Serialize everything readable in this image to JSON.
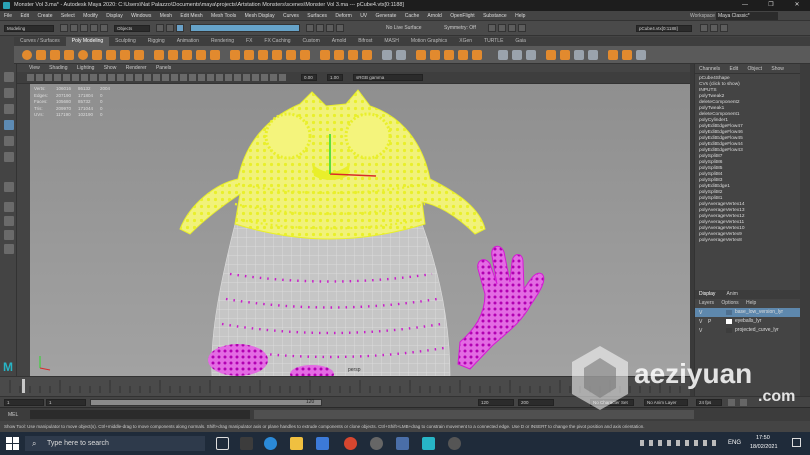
{
  "window": {
    "title": "Monster Vol 3.ma* - Autodesk Maya 2020: C:\\Users\\Nat Palazzo\\Documents\\maya\\projects\\Artstation Monsters\\scenes\\Monster Vol 3.ma  ---  pCube4.vtx[0:1188]",
    "minimize": "—",
    "maximize": "❐",
    "close": "✕"
  },
  "menu": [
    "File",
    "Edit",
    "Create",
    "Select",
    "Modify",
    "Display",
    "Windows",
    "Mesh",
    "Edit Mesh",
    "Mesh Tools",
    "Mesh Display",
    "Curves",
    "Surfaces",
    "Deform",
    "UV",
    "Generate",
    "Cache",
    "Arnold",
    "OpenFlight",
    "Substance",
    "Help"
  ],
  "workspace": {
    "label": "Workspace :",
    "value": "Maya Classic*"
  },
  "statusline": {
    "mode": "Modeling",
    "objects": "Objects",
    "live_surface": "No Live Surface",
    "symmetry": "Symmetry: Off",
    "selection_field": "pCube4.vtx[0:1188]"
  },
  "shelf_tabs": [
    "Curves / Surfaces",
    "Poly Modeling",
    "Sculpting",
    "Rigging",
    "Animation",
    "Rendering",
    "FX",
    "FX Caching",
    "Custom",
    "Arnold",
    "Bifrost",
    "MASH",
    "Motion Graphics",
    "XGen",
    "TURTLE",
    "Gaia"
  ],
  "shelf_active": "Poly Modeling",
  "viewport_menu": [
    "View",
    "Shading",
    "Lighting",
    "Show",
    "Renderer",
    "Panels"
  ],
  "viewport_fields": {
    "value_a": "0.00",
    "value_b": "1.00",
    "colorspace": "sRGB gamma"
  },
  "hud": {
    "rows": [
      {
        "label": "Verts:",
        "a": "106016",
        "b": "86132",
        "c": "2004"
      },
      {
        "label": "Edges:",
        "a": "207190",
        "b": "171804",
        "c": "0"
      },
      {
        "label": "Faces:",
        "a": "105680",
        "b": "85732",
        "c": "0"
      },
      {
        "label": "Tris:",
        "a": "209970",
        "b": "171044",
        "c": "0"
      },
      {
        "label": "UVs:",
        "a": "117190",
        "b": "102190",
        "c": "0"
      }
    ]
  },
  "camera": "persp",
  "channel_box": {
    "tabs": [
      "Channels",
      "Edit",
      "Object",
      "Show"
    ],
    "items": [
      "pCube4Shape",
      "CVs (click to show)",
      "INPUTS",
      "polyTweak2",
      "deleteComponent2",
      "polyTweak1",
      "deleteComponent1",
      "polyCylinder1",
      "polyEditEdgeFlow47",
      "polyEditEdgeFlow46",
      "polyEditEdgeFlow45",
      "polyEditEdgeFlow44",
      "polyEditEdgeFlow43",
      "polySplit87",
      "polySplit86",
      "polySplit85",
      "polySplit84",
      "polySplit83",
      "polyEditEdge1",
      "polySplit82",
      "polySplit81",
      "polyAverageVertex14",
      "polyAverageVertex13",
      "polyAverageVertex12",
      "polyAverageVertex11",
      "polyAverageVertex10",
      "polyAverageVertex9",
      "polyAverageVertex8"
    ]
  },
  "layer_panel": {
    "tabs": [
      "Display",
      "Anim"
    ],
    "menu": [
      "Layers",
      "Options",
      "Help"
    ],
    "layers": [
      {
        "v": "V",
        "p": "",
        "name": "base_low_version_lyr",
        "color": "#4e6f8f"
      },
      {
        "v": "V",
        "p": "P",
        "name": "eyeballs_lyr",
        "color": "#ffffff"
      },
      {
        "v": "V",
        "p": "",
        "name": "projected_curve_lyr",
        "color": "#3d3d3d"
      }
    ]
  },
  "range": {
    "start": "1",
    "start2": "1",
    "end": "120",
    "end2": "120",
    "end3": "200",
    "character_set": "No Character Set",
    "anim_layer": "No Anim Layer",
    "fps": "24 fps"
  },
  "mel_label": "MEL",
  "help_text": "Show Tool: Use manipulator to move object(s). Ctrl+middle-drag to move components along normals. Shift+drag manipulator axis or plane handles to extrude components or clone objects. Ctrl+Shift+LMB+drag to constrain movement to a connected edge. Use D or INSERT to change the pivot position and axis orientation.",
  "taskbar": {
    "search_placeholder": "Type here to search",
    "lang": "ENG",
    "time": "17:50",
    "date": "18/02/2021"
  },
  "watermark": {
    "text": "aeziyuan",
    "sub": ".com"
  },
  "colors": {
    "vertex_selected": "#e9ef2a",
    "vertex_magenta": "#d61ad6",
    "shelf_orange": "#e28a2e",
    "viewport_bg": "#999999"
  }
}
